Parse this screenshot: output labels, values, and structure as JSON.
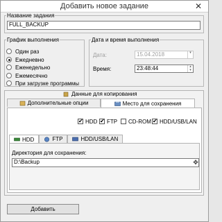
{
  "window": {
    "title": "Добавить новое задание",
    "close_glyph": "✕"
  },
  "task_name": {
    "legend": "Название задания",
    "value": "FULL_BACKUP"
  },
  "schedule": {
    "legend": "График выполнения",
    "options": [
      "Один раз",
      "Ежедневно",
      "Еженедельно",
      "Ежемесячно",
      "При загрузке программы"
    ],
    "selected": 1
  },
  "datetime": {
    "legend": "Дата и время выполнения",
    "date_label": "Дата:",
    "date_value": "15.04.2018",
    "time_label": "Время:",
    "time_value": "23:48:44"
  },
  "main_tabs": {
    "data_tab": "Данные для копирования"
  },
  "sub_tabs": {
    "extra_tab": "Дополнительные опции",
    "save_tab": "Место для сохранения"
  },
  "destinations": [
    {
      "label": "HDD",
      "checked": true
    },
    {
      "label": "FTP",
      "checked": true
    },
    {
      "label": "CD-ROM",
      "checked": false
    },
    {
      "label": "HDD/USB/LAN",
      "checked": true
    }
  ],
  "dest_tabs": [
    "HDD",
    "FTP",
    "HDD/USB/LAN"
  ],
  "save_dir": {
    "label": "Директория для сохранения:",
    "value": "D:\\Backup",
    "browse_glyph": "✥"
  },
  "add_button": "Добавить",
  "colors": {
    "border": "#b8b8b8",
    "panel": "#efefef",
    "active_tab": "#ffffff"
  }
}
